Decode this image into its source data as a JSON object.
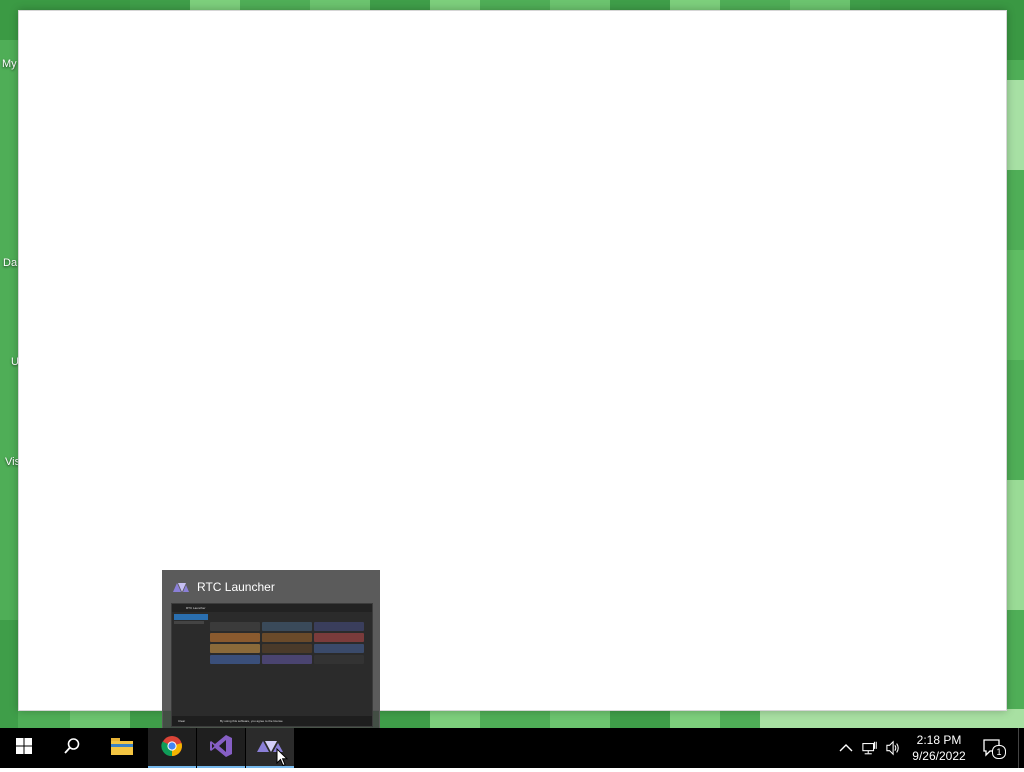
{
  "desktop": {
    "icon_labels": [
      "My",
      "Da",
      "U",
      "Vis"
    ]
  },
  "thumbnail": {
    "title": "RTC Launcher",
    "preview_title": "RTC Launcher",
    "preview_status_left": "Clear",
    "preview_status_right": "By using this software, you agree to the license"
  },
  "taskbar": {
    "apps": [
      {
        "name": "Start",
        "icon": "windows-logo-icon"
      },
      {
        "name": "Search",
        "icon": "search-icon"
      },
      {
        "name": "File Explorer",
        "icon": "folder-icon"
      },
      {
        "name": "Google Chrome",
        "icon": "chrome-icon"
      },
      {
        "name": "Visual Studio",
        "icon": "visual-studio-icon"
      },
      {
        "name": "RTC Launcher",
        "icon": "rtc-launcher-icon"
      }
    ],
    "clock_time": "2:18 PM",
    "clock_date": "9/26/2022",
    "notification_count": "1"
  },
  "colors": {
    "taskbar": "#000000",
    "accent": "#76b9ed",
    "desktop_green": "#4fae57"
  }
}
